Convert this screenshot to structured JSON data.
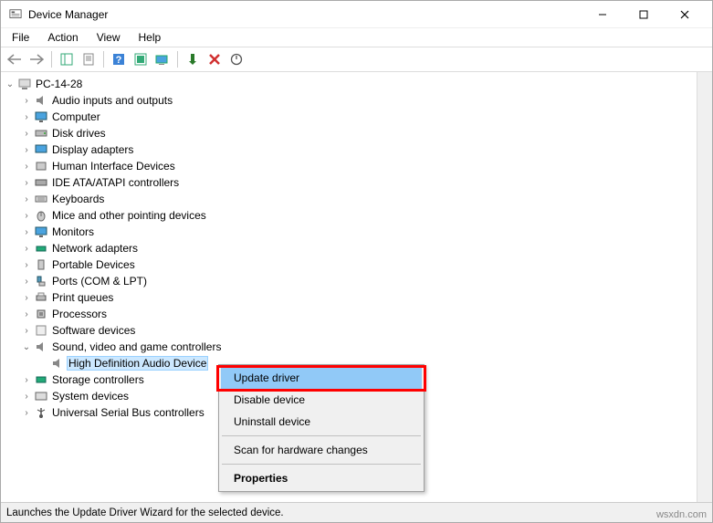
{
  "window": {
    "title": "Device Manager"
  },
  "menubar": {
    "file": "File",
    "action": "Action",
    "view": "View",
    "help": "Help"
  },
  "tree": {
    "root": "PC-14-28",
    "items": [
      "Audio inputs and outputs",
      "Computer",
      "Disk drives",
      "Display adapters",
      "Human Interface Devices",
      "IDE ATA/ATAPI controllers",
      "Keyboards",
      "Mice and other pointing devices",
      "Monitors",
      "Network adapters",
      "Portable Devices",
      "Ports (COM & LPT)",
      "Print queues",
      "Processors",
      "Software devices",
      "Sound, video and game controllers",
      "Storage controllers",
      "System devices",
      "Universal Serial Bus controllers"
    ],
    "expanded_child": "High Definition Audio Device"
  },
  "context_menu": {
    "update": "Update driver",
    "disable": "Disable device",
    "uninstall": "Uninstall device",
    "scan": "Scan for hardware changes",
    "properties": "Properties"
  },
  "statusbar": {
    "text": "Launches the Update Driver Wizard for the selected device."
  },
  "watermark": "wsxdn.com"
}
